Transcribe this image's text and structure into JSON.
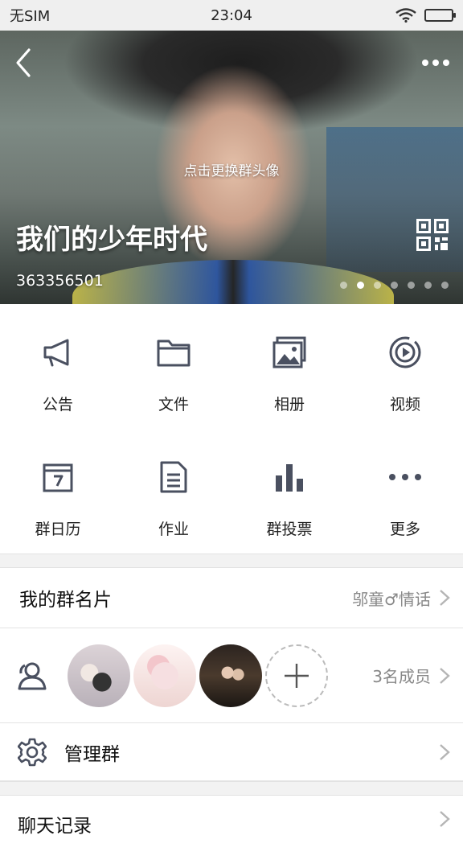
{
  "status_bar": {
    "carrier": "无SIM",
    "time": "23:04"
  },
  "header": {
    "change_avatar_hint": "点击更换群头像",
    "group_name": "我们的少年时代",
    "group_id": "363356501",
    "page_dots": 7,
    "active_dot": 1
  },
  "features": [
    {
      "label": "公告",
      "icon": "megaphone-icon"
    },
    {
      "label": "文件",
      "icon": "folder-icon"
    },
    {
      "label": "相册",
      "icon": "photo-album-icon"
    },
    {
      "label": "视频",
      "icon": "video-play-icon"
    },
    {
      "label": "群日历",
      "icon": "calendar-icon"
    },
    {
      "label": "作业",
      "icon": "document-icon"
    },
    {
      "label": "群投票",
      "icon": "bar-chart-icon"
    },
    {
      "label": "更多",
      "icon": "more-dots-icon"
    }
  ],
  "my_card": {
    "title": "我的群名片",
    "value": "邬童♂情话"
  },
  "members": {
    "count_label": "3名成员"
  },
  "manage": {
    "title": "管理群"
  },
  "chat_history": {
    "title": "聊天记录"
  },
  "colors": {
    "icon": "#4a5060",
    "divider": "#f2f2f2",
    "text_secondary": "#888888"
  }
}
